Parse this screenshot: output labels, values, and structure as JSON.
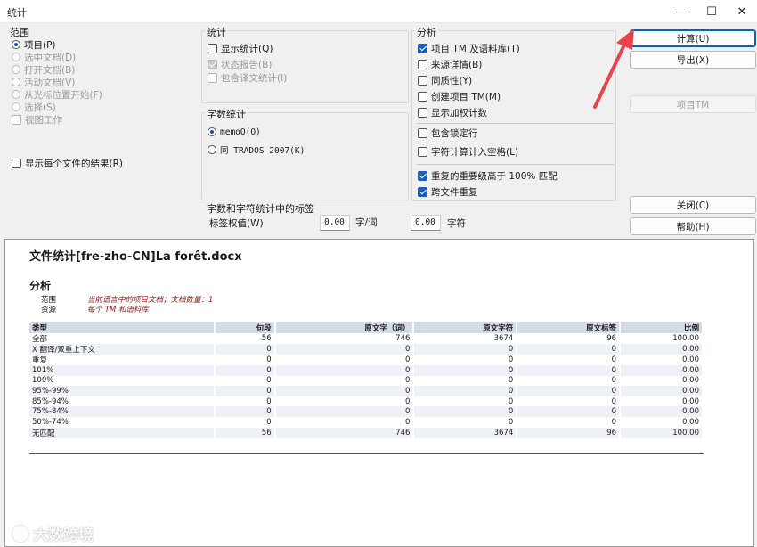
{
  "window": {
    "title": "统计",
    "min_icon": "—",
    "max_icon": "☐",
    "close_icon": "✕"
  },
  "scope": {
    "title": "范围",
    "options": [
      {
        "label": "项目(P)",
        "checked": true,
        "disabled": false
      },
      {
        "label": "选中文档(D)",
        "checked": false,
        "disabled": true
      },
      {
        "label": "打开文档(B)",
        "checked": false,
        "disabled": true
      },
      {
        "label": "活动文档(V)",
        "checked": false,
        "disabled": true
      },
      {
        "label": "从光标位置开始(F)",
        "checked": false,
        "disabled": true
      },
      {
        "label": "选择(S)",
        "checked": false,
        "disabled": true
      }
    ],
    "view_work": "视图工作",
    "per_file": "显示每个文件的结果(R)"
  },
  "stats": {
    "title": "统计",
    "show_stats": "显示统计(Q)",
    "status_report": "状态报告(B)",
    "include_translated": "包含译文统计(I)"
  },
  "wordcount": {
    "title": "字数统计",
    "opt1": "memoQ(O)",
    "opt2": "同 TRADOS 2007(K)"
  },
  "tags": {
    "title": "字数和字符统计中的标签",
    "weight_label": "标签权值(W)",
    "weight_value": "0.00",
    "unit1": "字/词",
    "char_value": "0.00",
    "unit2": "字符"
  },
  "analysis": {
    "title": "分析",
    "items": [
      {
        "label": "项目 TM 及语料库(T)",
        "checked": true
      },
      {
        "label": "来源详情(B)",
        "checked": false
      },
      {
        "label": "同质性(Y)",
        "checked": false
      },
      {
        "label": "创建项目 TM(M)",
        "checked": false
      },
      {
        "label": "显示加权计数",
        "checked": false
      }
    ],
    "items2": [
      {
        "label": "包含锁定行",
        "checked": false
      },
      {
        "label": "字符计算计入空格(L)",
        "checked": false
      }
    ],
    "items3": [
      {
        "label": "重复的重要级高于 100% 匹配",
        "checked": true
      },
      {
        "label": "跨文件重复",
        "checked": true
      }
    ]
  },
  "buttons": {
    "calculate": "计算(U)",
    "export": "导出(X)",
    "project_tm": "项目TM",
    "close": "关闭(C)",
    "help": "帮助(H)"
  },
  "report": {
    "title": "文件统计[fre-zho-CN]La forêt.docx",
    "section": "分析",
    "meta": [
      {
        "key": "范围",
        "value": "当前语言中的项目文档；文档数量：1"
      },
      {
        "key": "资源",
        "value": "每个 TM 和语料库"
      }
    ],
    "columns": [
      "类型",
      "句段",
      "原文字（词）",
      "原文字符",
      "原文标签",
      "比例"
    ],
    "rows": [
      [
        "全部",
        "56",
        "746",
        "3674",
        "96",
        "100.00"
      ],
      [
        "X 翻译/双重上下文",
        "0",
        "0",
        "0",
        "0",
        "0.00"
      ],
      [
        "重复",
        "0",
        "0",
        "0",
        "0",
        "0.00"
      ],
      [
        "101%",
        "0",
        "0",
        "0",
        "0",
        "0.00"
      ],
      [
        "100%",
        "0",
        "0",
        "0",
        "0",
        "0.00"
      ],
      [
        "95%-99%",
        "0",
        "0",
        "0",
        "0",
        "0.00"
      ],
      [
        "85%-94%",
        "0",
        "0",
        "0",
        "0",
        "0.00"
      ],
      [
        "75%-84%",
        "0",
        "0",
        "0",
        "0",
        "0.00"
      ],
      [
        "50%-74%",
        "0",
        "0",
        "0",
        "0",
        "0.00"
      ],
      [
        "无匹配",
        "56",
        "746",
        "3674",
        "96",
        "100.00"
      ]
    ]
  },
  "watermark": "大数跨境",
  "colors": {
    "accent": "#0067c0",
    "header_fill": "#d6dde6",
    "meta_value": "#8b1a1a",
    "arrow": "#e8444a"
  }
}
